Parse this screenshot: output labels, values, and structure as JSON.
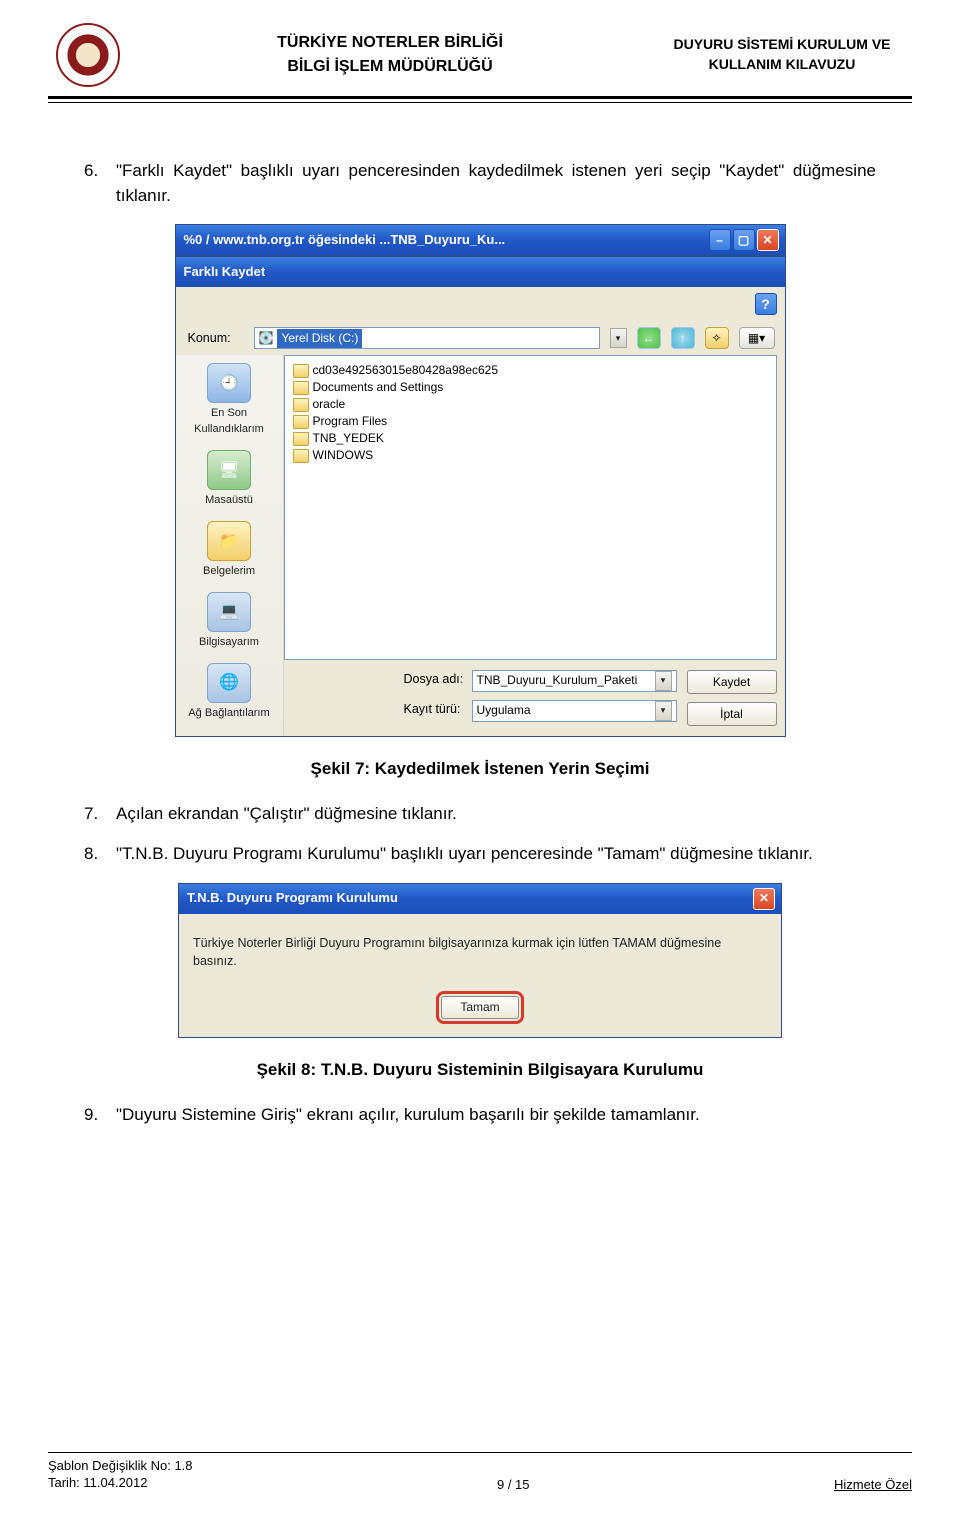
{
  "header": {
    "center_line1": "TÜRKİYE NOTERLER BİRLİĞİ",
    "center_line2": "BİLGİ İŞLEM MÜDÜRLÜĞÜ",
    "right_line1": "DUYURU SİSTEMİ KURULUM VE",
    "right_line2": "KULLANIM KILAVUZU"
  },
  "steps": {
    "s6_num": "6.",
    "s6_text": "\"Farklı Kaydet\" başlıklı uyarı penceresinden kaydedilmek istenen yeri seçip \"Kaydet\" düğmesine tıklanır.",
    "s7_num": "7.",
    "s7_text": "Açılan ekrandan \"Çalıştır\" düğmesine tıklanır.",
    "s8_num": "8.",
    "s8_text": "\"T.N.B. Duyuru Programı Kurulumu\" başlıklı uyarı penceresinde \"Tamam\" düğmesine tıklanır.",
    "s9_num": "9.",
    "s9_text": "\"Duyuru Sistemine Giriş\" ekranı açılır, kurulum başarılı bir şekilde tamamlanır."
  },
  "captions": {
    "fig7": "Şekil 7: Kaydedilmek İstenen Yerin Seçimi",
    "fig8": "Şekil 8: T.N.B. Duyuru Sisteminin Bilgisayara Kurulumu"
  },
  "download_bar": {
    "title": "%0 / www.tnb.org.tr öğesindeki ...TNB_Duyuru_Ku..."
  },
  "save_dialog": {
    "title": "Farklı Kaydet",
    "help": "?",
    "location_label": "Konum:",
    "location_value": "Yerel Disk (C:)",
    "toolbar": {
      "back": "←",
      "up": "↑",
      "new": "✧",
      "views": "▦▾"
    },
    "places": [
      {
        "label": "En Son Kullandıklarım"
      },
      {
        "label": "Masaüstü"
      },
      {
        "label": "Belgelerim"
      },
      {
        "label": "Bilgisayarım"
      },
      {
        "label": "Ağ Bağlantılarım"
      }
    ],
    "files": [
      "cd03e492563015e80428a98ec625",
      "Documents and Settings",
      "oracle",
      "Program Files",
      "TNB_YEDEK",
      "WINDOWS"
    ],
    "filename_label": "Dosya adı:",
    "filename_value": "TNB_Duyuru_Kurulum_Paketi",
    "filetype_label": "Kayıt türü:",
    "filetype_value": "Uygulama",
    "save_btn": "Kaydet",
    "cancel_btn": "İptal"
  },
  "installer": {
    "title": "T.N.B. Duyuru Programı Kurulumu",
    "body": "Türkiye Noterler Birliği Duyuru Programını bilgisayarınıza kurmak için lütfen TAMAM düğmesine basınız.",
    "ok": "Tamam",
    "close": "✕"
  },
  "footer": {
    "left_line1": "Şablon Değişiklik No: 1.8",
    "left_line2": "Tarih: 11.04.2012",
    "center": "9 / 15",
    "right": "Hizmete Özel"
  }
}
